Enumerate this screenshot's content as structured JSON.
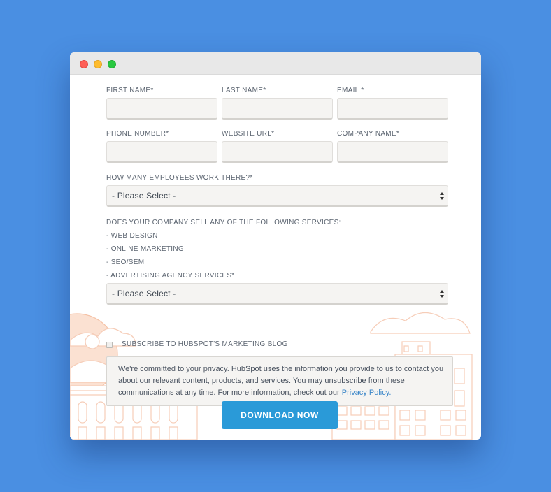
{
  "window": {
    "controls": [
      "close",
      "minimize",
      "zoom"
    ]
  },
  "form": {
    "fields": {
      "first_name": {
        "label": "FIRST NAME*",
        "value": ""
      },
      "last_name": {
        "label": "LAST NAME*",
        "value": ""
      },
      "email": {
        "label": "EMAIL *",
        "value": ""
      },
      "phone": {
        "label": "PHONE NUMBER*",
        "value": ""
      },
      "website": {
        "label": "WEBSITE URL*",
        "value": ""
      },
      "company": {
        "label": "COMPANY NAME*",
        "value": ""
      }
    },
    "employees": {
      "label": "HOW MANY EMPLOYEES WORK THERE?*",
      "selected": "- Please Select -"
    },
    "services": {
      "question": "DOES YOUR COMPANY SELL ANY OF THE FOLLOWING SERVICES:",
      "items": [
        "- WEB DESIGN",
        "- ONLINE MARKETING",
        "- SEO/SEM",
        "- ADVERTISING AGENCY SERVICES*"
      ],
      "selected": "- Please Select -"
    },
    "subscribe": {
      "label": "SUBSCRIBE TO HUBSPOT'S MARKETING BLOG",
      "checked": false
    },
    "privacy": {
      "text": "We're committed to your privacy. HubSpot uses the information you provide to us to contact you about our relevant content, products, and services. You may unsubscribe from these communications at any time. For more information, check out our",
      "link_label": "Privacy Policy."
    },
    "submit_label": "DOWNLOAD NOW"
  },
  "colors": {
    "background": "#4a8fe2",
    "button": "#2a9ad8",
    "illustration": "#f5c9b1",
    "link": "#3b86c8"
  },
  "icons": [
    "select-arrows-icon",
    "checkbox-icon"
  ]
}
